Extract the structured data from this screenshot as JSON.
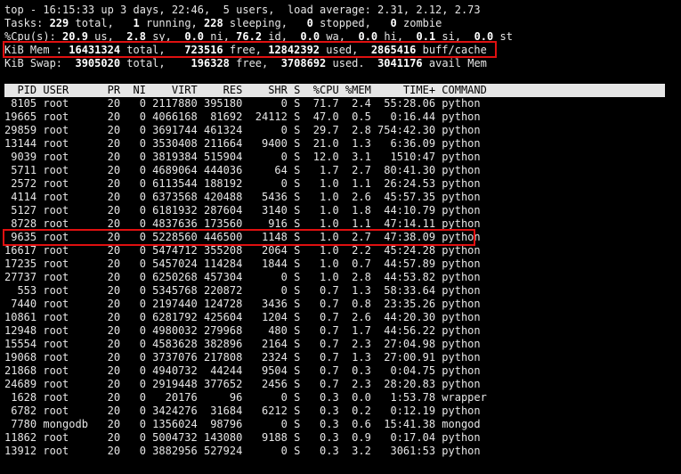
{
  "summary": {
    "line1_pre": "top - 16:15:33 up 3 days, 22:46,  ",
    "line1_users": "5 users",
    "line1_post": ",  load average: 2.31, 2.12, 2.73",
    "tasks": [
      {
        "t": "Tasks: ",
        "b": false
      },
      {
        "t": "229",
        "b": true
      },
      {
        "t": " total,   ",
        "b": false
      },
      {
        "t": "1",
        "b": true
      },
      {
        "t": " running, ",
        "b": false
      },
      {
        "t": "228",
        "b": true
      },
      {
        "t": " sleeping,   ",
        "b": false
      },
      {
        "t": "0",
        "b": true
      },
      {
        "t": " stopped,   ",
        "b": false
      },
      {
        "t": "0",
        "b": true
      },
      {
        "t": " zombie",
        "b": false
      }
    ],
    "cpu": [
      {
        "t": "%Cpu(s): ",
        "b": false
      },
      {
        "t": "20.9",
        "b": true
      },
      {
        "t": " us,  ",
        "b": false
      },
      {
        "t": "2.8",
        "b": true
      },
      {
        "t": " sy,  ",
        "b": false
      },
      {
        "t": "0.0",
        "b": true
      },
      {
        "t": " ni, ",
        "b": false
      },
      {
        "t": "76.2",
        "b": true
      },
      {
        "t": " id,  ",
        "b": false
      },
      {
        "t": "0.0",
        "b": true
      },
      {
        "t": " wa,  ",
        "b": false
      },
      {
        "t": "0.0",
        "b": true
      },
      {
        "t": " hi,  ",
        "b": false
      },
      {
        "t": "0.1",
        "b": true
      },
      {
        "t": " si,  ",
        "b": false
      },
      {
        "t": "0.0",
        "b": true
      },
      {
        "t": " st",
        "b": false
      }
    ],
    "mem": [
      {
        "t": "KiB Mem : ",
        "b": false
      },
      {
        "t": "16431324",
        "b": true
      },
      {
        "t": " total,   ",
        "b": false
      },
      {
        "t": "723516",
        "b": true
      },
      {
        "t": " free, ",
        "b": false
      },
      {
        "t": "12842392",
        "b": true
      },
      {
        "t": " used,  ",
        "b": false
      },
      {
        "t": "2865416",
        "b": true
      },
      {
        "t": " buff/cache",
        "b": false
      }
    ],
    "swap": [
      {
        "t": "KiB Swap:  ",
        "b": false
      },
      {
        "t": "3905020",
        "b": true
      },
      {
        "t": " total,    ",
        "b": false
      },
      {
        "t": "196328",
        "b": true
      },
      {
        "t": " free,  ",
        "b": false
      },
      {
        "t": "3708692",
        "b": true
      },
      {
        "t": " used.  ",
        "b": false
      },
      {
        "t": "3041176",
        "b": true
      },
      {
        "t": " avail Mem",
        "b": false
      }
    ]
  },
  "table": {
    "header": "  PID USER      PR  NI    VIRT    RES    SHR S  %CPU %MEM     TIME+ COMMAND",
    "rows": [
      " 8105 root      20   0 2117880 395180      0 S  71.7  2.4  55:28.06 python",
      "19665 root      20   0 4066168  81692  24112 S  47.0  0.5   0:16.44 python",
      "29859 root      20   0 3691744 461324      0 S  29.7  2.8 754:42.30 python",
      "13144 root      20   0 3530408 211664   9400 S  21.0  1.3   6:36.09 python",
      " 9039 root      20   0 3819384 515904      0 S  12.0  3.1   1510:47 python",
      " 5711 root      20   0 4689064 444036     64 S   1.7  2.7  80:41.30 python",
      " 2572 root      20   0 6113544 188192      0 S   1.0  1.1  26:24.53 python",
      " 4114 root      20   0 6373568 420488   5436 S   1.0  2.6  45:57.35 python",
      " 5127 root      20   0 6181932 287604   3140 S   1.0  1.8  44:10.79 python",
      " 8728 root      20   0 4837636 173560    916 S   1.0  1.1  47:14.11 python",
      " 9635 root      20   0 5228560 446500   1148 S   1.0  2.7  47:38.09 python",
      "16617 root      20   0 5474712 355208   2064 S   1.0  2.2  45:24.28 python",
      "17235 root      20   0 5457024 114284   1844 S   1.0  0.7  44:57.89 python",
      "27737 root      20   0 6250268 457304      0 S   1.0  2.8  44:53.82 python",
      "  553 root      20   0 5345768 220872      0 S   0.7  1.3  58:33.64 python",
      " 7440 root      20   0 2197440 124728   3436 S   0.7  0.8  23:35.26 python",
      "10861 root      20   0 6281792 425604   1204 S   0.7  2.6  44:20.30 python",
      "12948 root      20   0 4980032 279968    480 S   0.7  1.7  44:56.22 python",
      "15554 root      20   0 4583628 382896   2164 S   0.7  2.3  27:04.98 python",
      "19068 root      20   0 3737076 217808   2324 S   0.7  1.3  27:00.91 python",
      "21868 root      20   0 4940732  44244   9504 S   0.7  0.3   0:04.75 python",
      "24689 root      20   0 2919448 377652   2456 S   0.7  2.3  28:20.83 python",
      " 1628 root      20   0   20176     96      0 S   0.3  0.0   1:53.78 wrapper",
      " 6782 root      20   0 3424276  31684   6212 S   0.3  0.2   0:12.19 python",
      " 7780 mongodb   20   0 1356024  98796      0 S   0.3  0.6  15:41.38 mongod",
      "11862 root      20   0 5004732 143080   9188 S   0.3  0.9   0:17.04 python",
      "13912 root      20   0 3882956 527924      0 S   0.3  3.2   3061:53 python"
    ]
  },
  "highlight_color": "#e01010"
}
